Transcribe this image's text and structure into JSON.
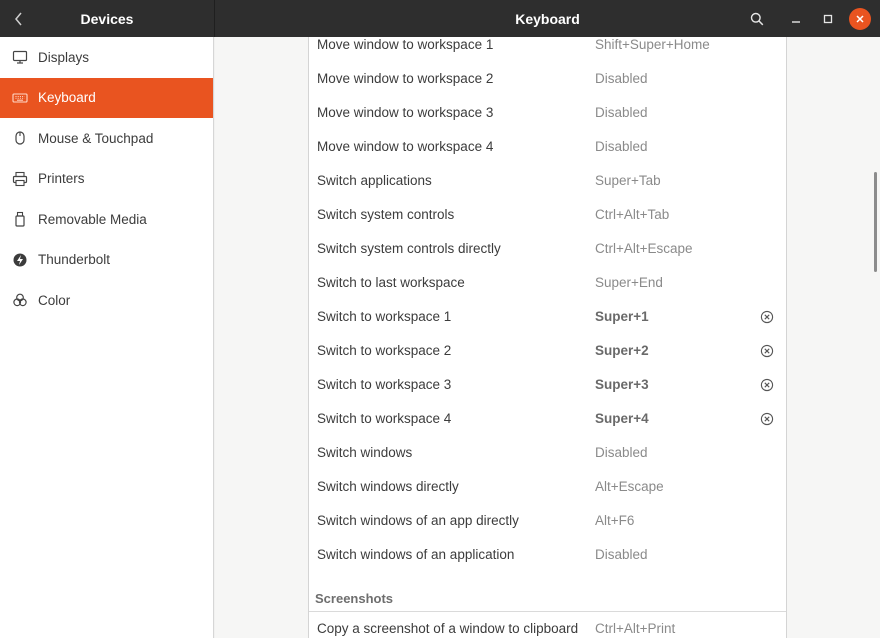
{
  "header": {
    "side_title": "Devices",
    "title": "Keyboard",
    "icons": {
      "back": "chevron-left-icon",
      "search": "search-icon",
      "minimize": "minimize-icon",
      "maximize": "maximize-icon",
      "close": "close-icon"
    }
  },
  "colors": {
    "accent": "#e95420",
    "header_bg": "#2e2e2e"
  },
  "sidebar": {
    "items": [
      {
        "label": "Displays",
        "icon": "display-icon"
      },
      {
        "label": "Keyboard",
        "icon": "keyboard-icon",
        "active": true
      },
      {
        "label": "Mouse & Touchpad",
        "icon": "mouse-icon"
      },
      {
        "label": "Printers",
        "icon": "printer-icon"
      },
      {
        "label": "Removable Media",
        "icon": "removable-media-icon"
      },
      {
        "label": "Thunderbolt",
        "icon": "thunderbolt-icon"
      },
      {
        "label": "Color",
        "icon": "color-icon"
      }
    ]
  },
  "shortcuts": [
    {
      "name": "Move window to workspace 1",
      "accel": "Shift+Super+Home"
    },
    {
      "name": "Move window to workspace 2",
      "accel": "Disabled"
    },
    {
      "name": "Move window to workspace 3",
      "accel": "Disabled"
    },
    {
      "name": "Move window to workspace 4",
      "accel": "Disabled"
    },
    {
      "name": "Switch applications",
      "accel": "Super+Tab"
    },
    {
      "name": "Switch system controls",
      "accel": "Ctrl+Alt+Tab"
    },
    {
      "name": "Switch system controls directly",
      "accel": "Ctrl+Alt+Escape"
    },
    {
      "name": "Switch to last workspace",
      "accel": "Super+End"
    },
    {
      "name": "Switch to workspace 1",
      "accel": "Super+1",
      "custom": true
    },
    {
      "name": "Switch to workspace 2",
      "accel": "Super+2",
      "custom": true
    },
    {
      "name": "Switch to workspace 3",
      "accel": "Super+3",
      "custom": true
    },
    {
      "name": "Switch to workspace 4",
      "accel": "Super+4",
      "custom": true
    },
    {
      "name": "Switch windows",
      "accel": "Disabled"
    },
    {
      "name": "Switch windows directly",
      "accel": "Alt+Escape"
    },
    {
      "name": "Switch windows of an app directly",
      "accel": "Alt+F6"
    },
    {
      "name": "Switch windows of an application",
      "accel": "Disabled"
    }
  ],
  "section": {
    "title": "Screenshots",
    "first_row": {
      "name": "Copy a screenshot of a window to clipboard",
      "accel": "Ctrl+Alt+Print"
    }
  }
}
